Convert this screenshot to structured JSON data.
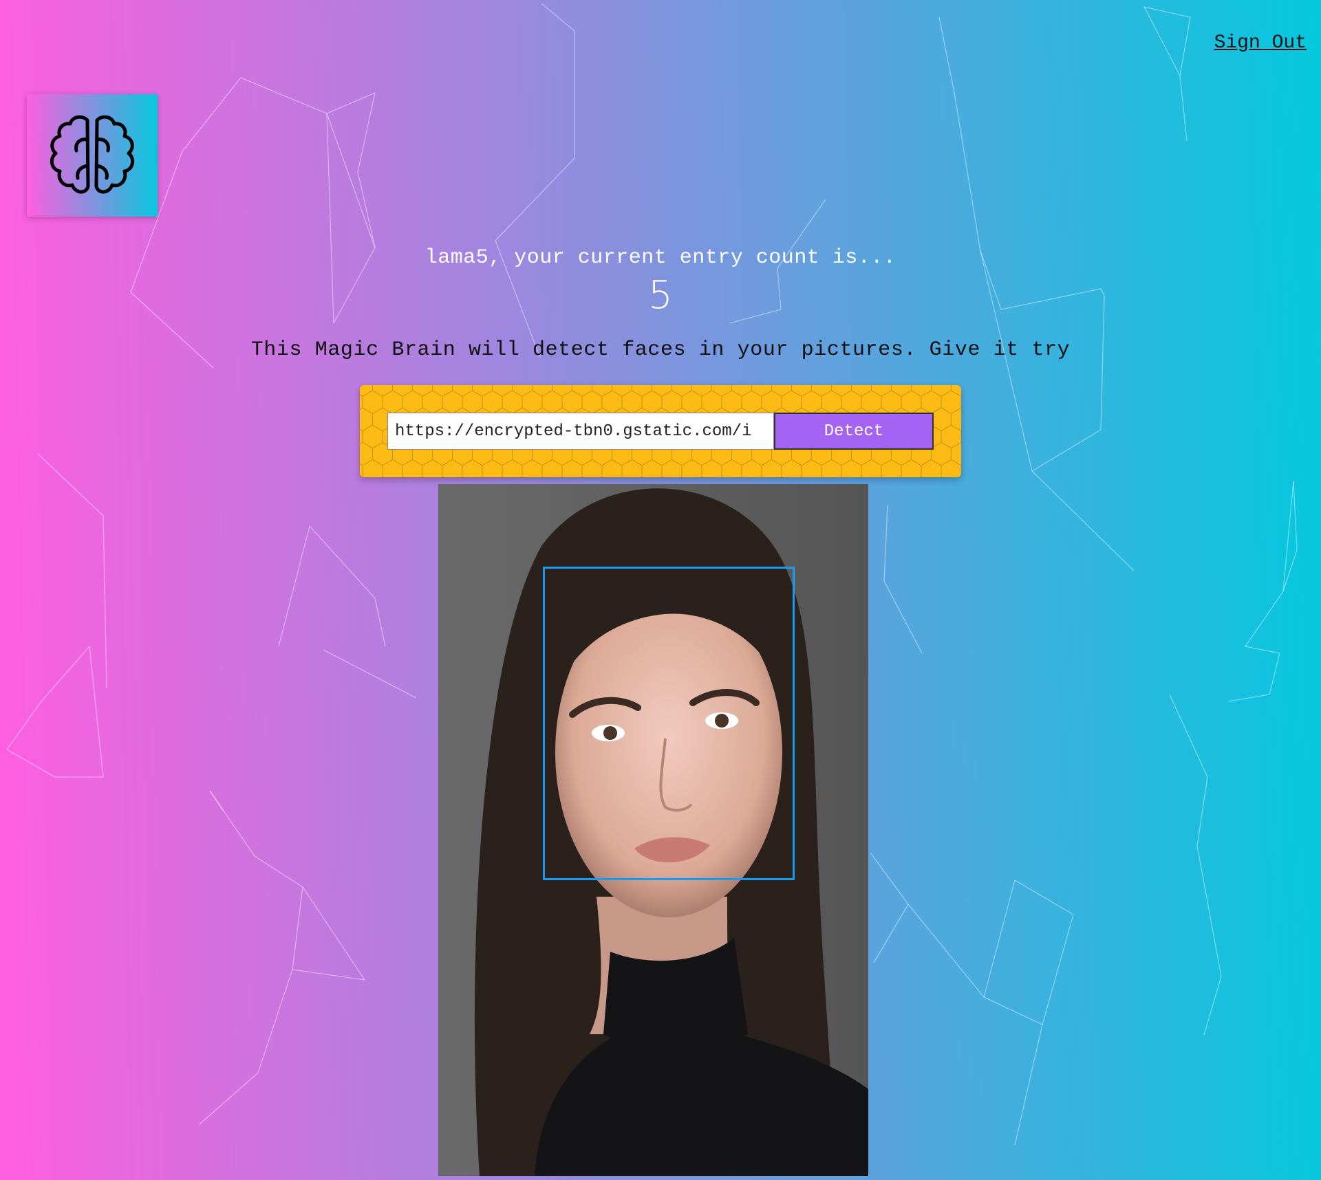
{
  "nav": {
    "sign_out_label": "Sign Out"
  },
  "logo": {
    "icon": "brain-icon"
  },
  "rank": {
    "message": "lama5, your current entry count is...",
    "count": "5"
  },
  "tagline": "This Magic Brain will detect faces in your pictures. Give it try",
  "image_form": {
    "url_value": "https://encrypted-tbn0.gstatic.com/i",
    "detect_label": "Detect"
  },
  "colors": {
    "gradient_start": "#ff5edf",
    "gradient_end": "#04c8de",
    "form_background": "#fcba14",
    "detect_button": "#a463f2",
    "bounding_box": "#149df2"
  }
}
